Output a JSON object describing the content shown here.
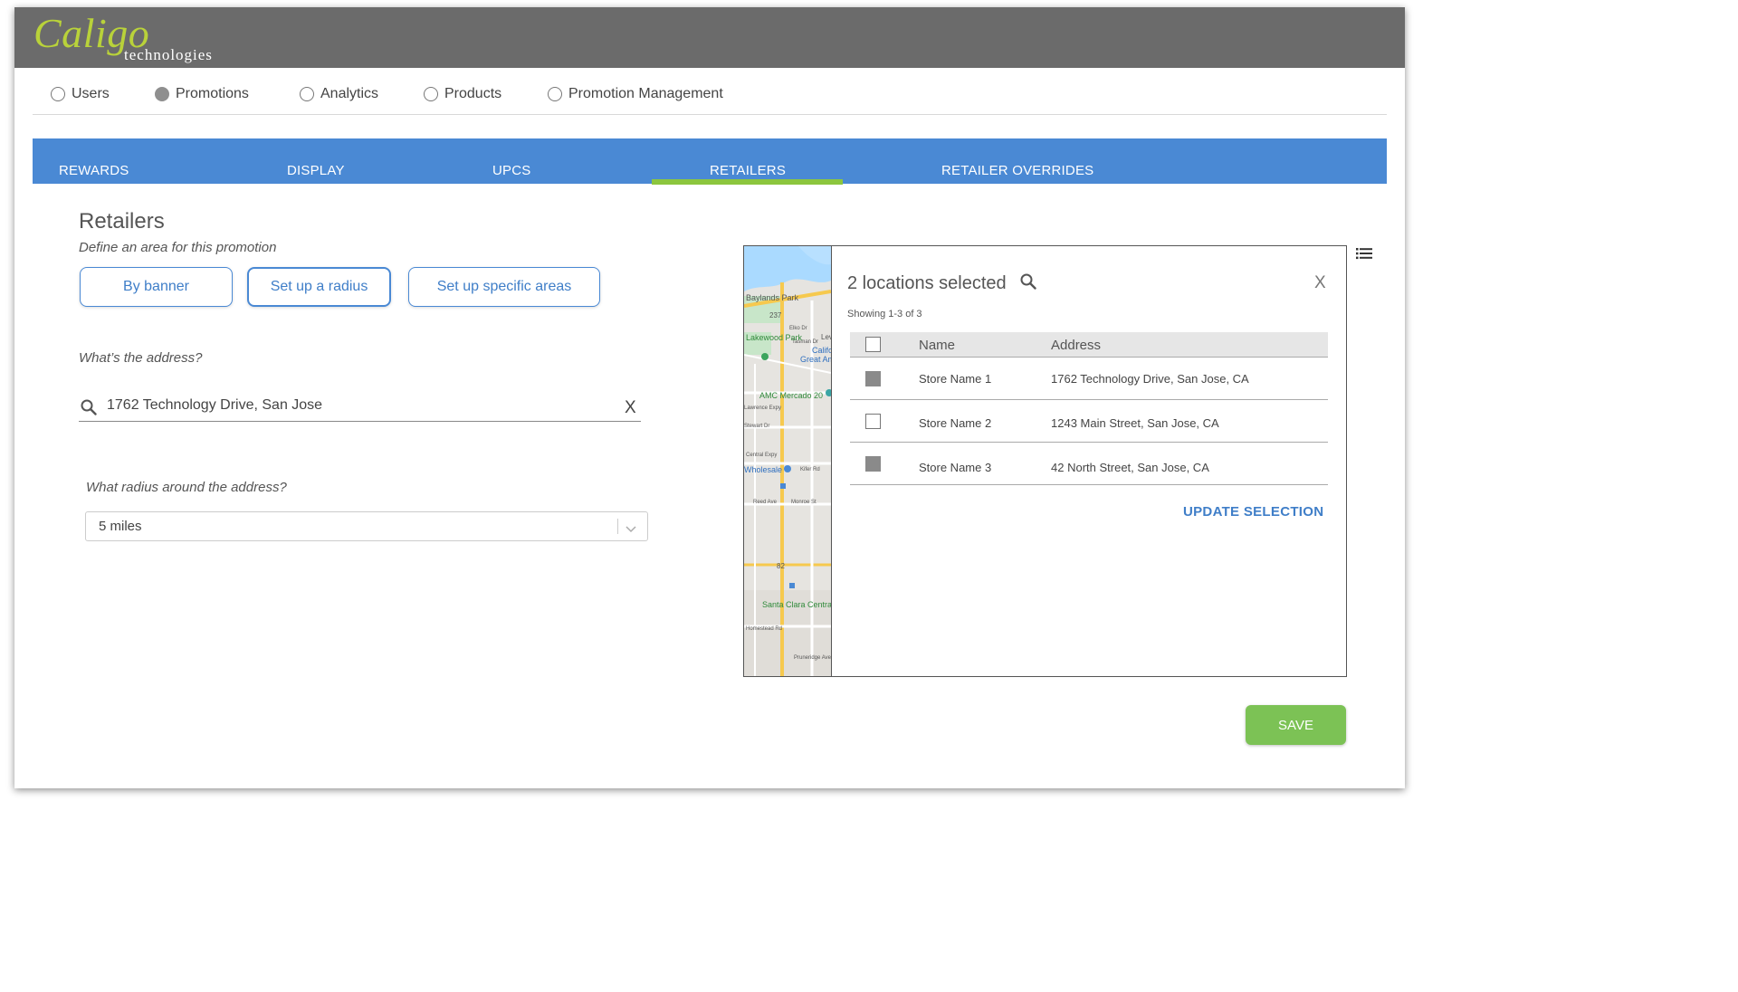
{
  "brand": {
    "name": "Caligo",
    "tagline": "technologies",
    "accent_color": "#b9d23a"
  },
  "top_nav": {
    "items": [
      {
        "label": "Users",
        "selected": false
      },
      {
        "label": "Promotions",
        "selected": true
      },
      {
        "label": "Analytics",
        "selected": false
      },
      {
        "label": "Products",
        "selected": false
      },
      {
        "label": "Promotion Management",
        "selected": false
      }
    ]
  },
  "tabs": {
    "items": [
      {
        "label": "REWARDS"
      },
      {
        "label": "DISPLAY"
      },
      {
        "label": "UPCS"
      },
      {
        "label": "RETAILERS"
      },
      {
        "label": "RETAILER OVERRIDES"
      }
    ],
    "active": "RETAILERS",
    "bar_color": "#4a89d4",
    "active_underline_color": "#8cc63e"
  },
  "retailers": {
    "title": "Retailers",
    "subtitle": "Define an area for this promotion",
    "modes": [
      {
        "label": "By banner",
        "active": false
      },
      {
        "label": "Set up a radius",
        "active": true
      },
      {
        "label": "Set up specific areas",
        "active": false
      }
    ],
    "address_question": "What’s the address?",
    "address_value": "1762 Technology Drive, San Jose",
    "address_clear": "X",
    "radius_question": "What radius around the address?",
    "radius_value": "5 miles"
  },
  "map": {
    "labels": [
      "Baylands Park",
      "237",
      "Elko Dr",
      "Tasman Dr",
      "Lakewood Park",
      "Lev",
      "Califo",
      "Great Am",
      "AMC Mercado 20",
      "Lawrence Expy",
      "Stewart Dr",
      "Central Expy",
      "Wholesale",
      "Kifer Rd",
      "Reed Ave",
      "Monroe St",
      "82",
      "Santa Clara Centra",
      "Homestead Rd",
      "Pruneridge Ave"
    ]
  },
  "locations_panel": {
    "heading": "2 locations selected",
    "close_label": "X",
    "showing": "Showing 1-3 of 3",
    "columns": {
      "name": "Name",
      "address": "Address"
    },
    "rows": [
      {
        "name": "Store Name 1",
        "address": "1762 Technology Drive, San Jose, CA",
        "checked": true
      },
      {
        "name": "Store Name 2",
        "address": "1243 Main Street, San Jose, CA",
        "checked": false
      },
      {
        "name": "Store Name 3",
        "address": "42 North Street, San Jose, CA",
        "checked": true
      }
    ],
    "update_label": "UPDATE SELECTION"
  },
  "actions": {
    "save_label": "SAVE",
    "save_color": "#7cc255"
  }
}
